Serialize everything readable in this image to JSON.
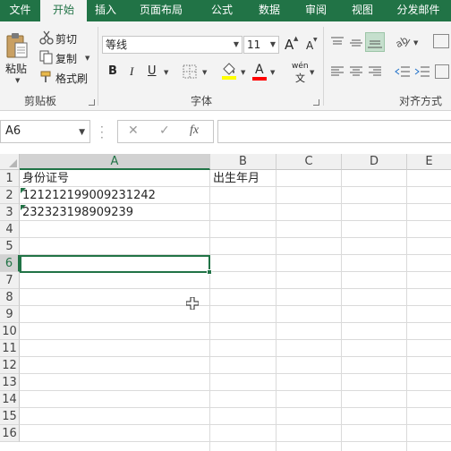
{
  "tabs": [
    "文件",
    "开始",
    "插入",
    "页面布局",
    "公式",
    "数据",
    "审阅",
    "视图",
    "分发邮件"
  ],
  "clipboard": {
    "paste": "粘贴",
    "cut": "剪切",
    "copy": "复制",
    "format_painter": "格式刷",
    "group_label": "剪贴板"
  },
  "font": {
    "font_name": "等线",
    "font_size": "11",
    "grow": "A",
    "shrink": "A",
    "bold": "B",
    "italic": "I",
    "underline": "U",
    "font_color_letter": "A",
    "phonetic_top": "wén",
    "phonetic_bottom": "文",
    "group_label": "字体",
    "fill_color": "#ffff00",
    "font_color": "#ff0000"
  },
  "alignment": {
    "group_label": "对齐方式"
  },
  "formula_bar": {
    "name_box": "A6",
    "cancel": "✕",
    "enter": "✓",
    "fx": "fx",
    "value": ""
  },
  "columns": [
    "A",
    "B",
    "C",
    "D",
    "E"
  ],
  "selected_column": "A",
  "rows": [
    "1",
    "2",
    "3",
    "4",
    "5",
    "6",
    "7",
    "8",
    "9",
    "10",
    "11",
    "12",
    "13",
    "14",
    "15",
    "16"
  ],
  "selected_row": "6",
  "cells": {
    "A1": "身份证号",
    "B1": "出生年月",
    "A2": "121212199009231242",
    "A3": "232323198909239"
  },
  "colors": {
    "excel_green": "#217346",
    "error_indicator": "#217346"
  }
}
